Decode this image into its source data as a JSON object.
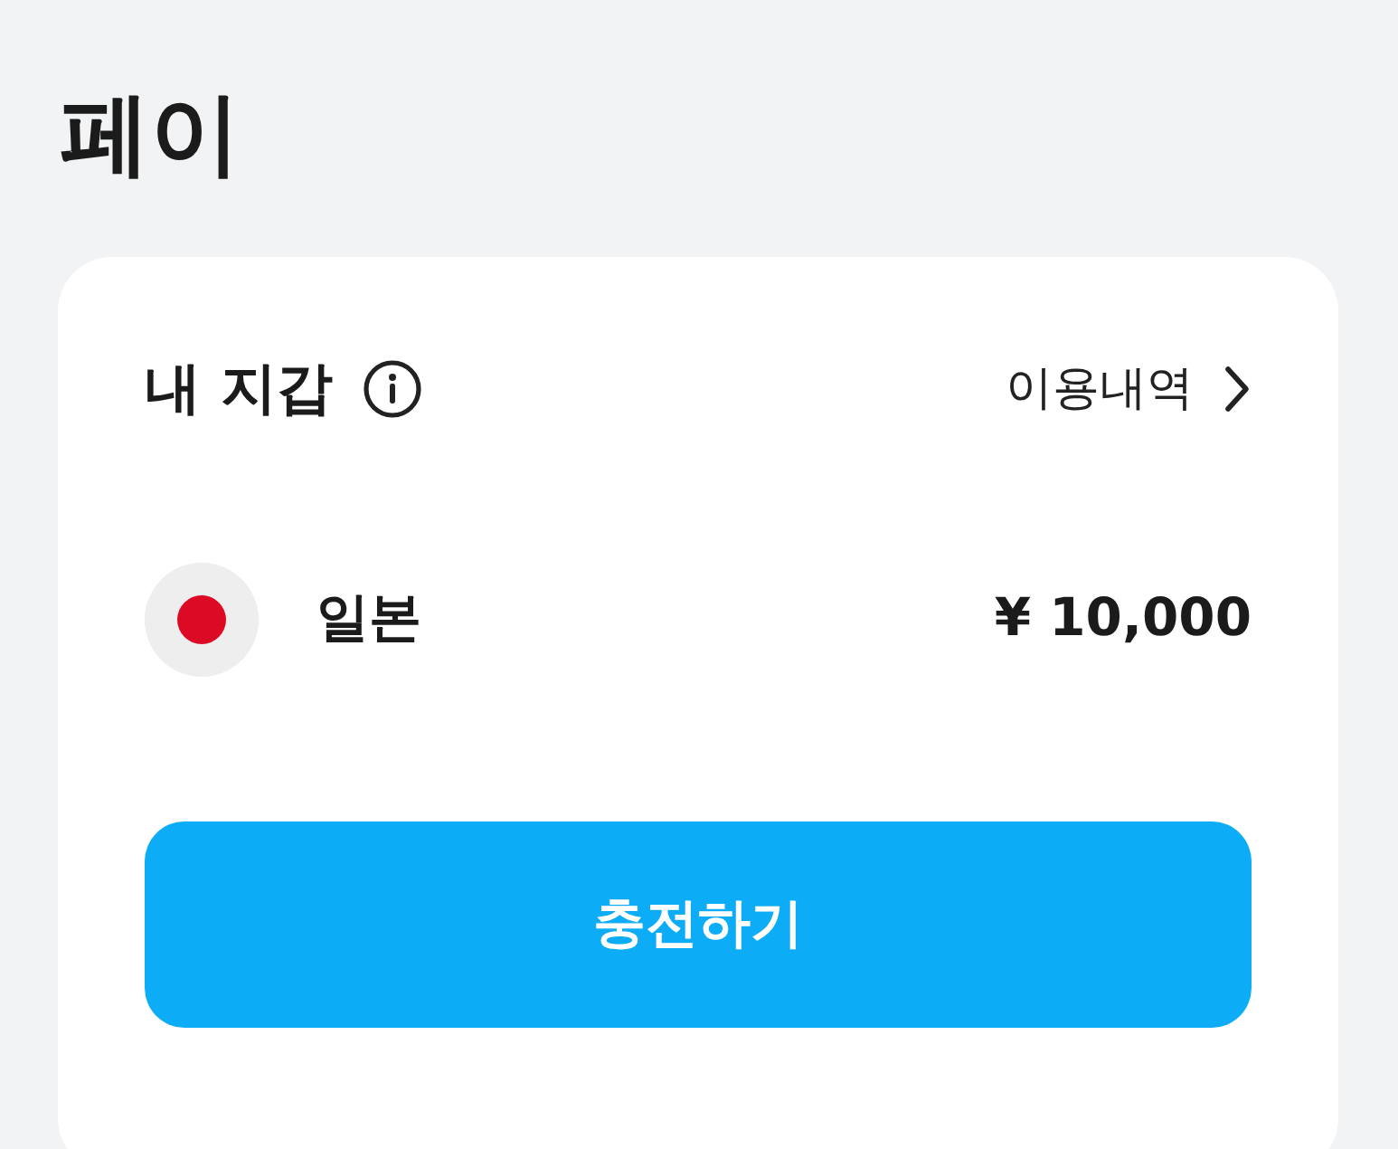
{
  "title": "페이",
  "wallet": {
    "title": "내 지갑",
    "history_link": "이용내역"
  },
  "balances": [
    {
      "country": "일본",
      "amount": "¥ 10,000"
    }
  ],
  "charge_button": "충전하기"
}
